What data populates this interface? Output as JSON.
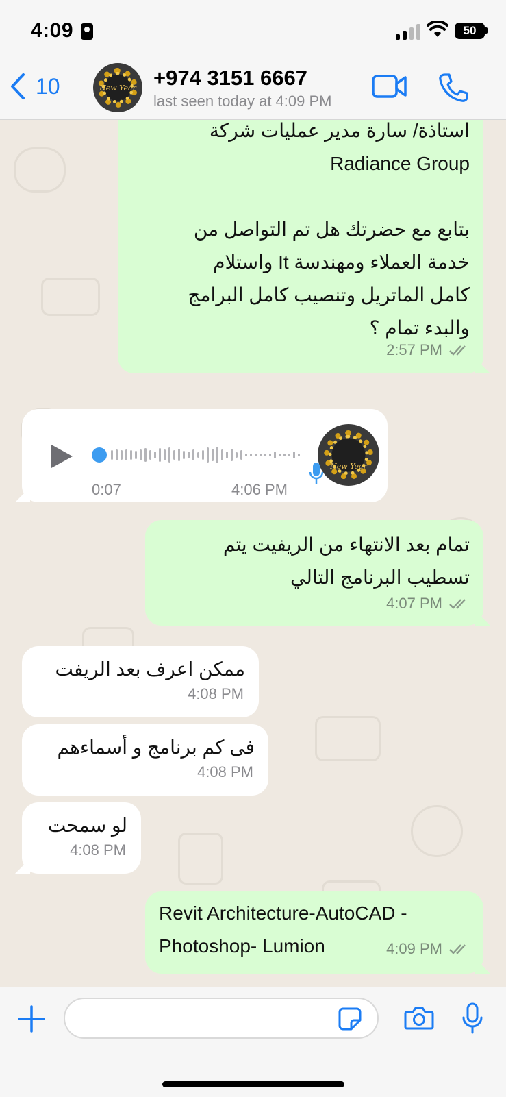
{
  "status_bar": {
    "time": "4:09",
    "battery": "50"
  },
  "header": {
    "back_count": "10",
    "contact_name": "+974 3151 6667",
    "last_seen": "last seen today at 4:09 PM",
    "avatar_text": "New Year",
    "icons": {
      "back": "chevron-left-icon",
      "video": "video-camera-icon",
      "call": "phone-icon"
    }
  },
  "messages": [
    {
      "direction": "out",
      "lines": [
        "استاذة/ سارة مدير عمليات شركة",
        "Radiance Group",
        "",
        "بتابع مع حضرتك هل تم التواصل من",
        "خدمة العملاء ومهندسة It واستلام",
        "كامل الماتريل وتنصيب كامل البرامج",
        "والبدء تمام ؟"
      ],
      "time": "2:57 PM",
      "status": "read"
    },
    {
      "direction": "in",
      "type": "voice",
      "duration": "0:07",
      "time": "4:06 PM"
    },
    {
      "direction": "out",
      "lines": [
        "تمام بعد الانتهاء من الريفيت يتم",
        "تسطيب البرنامج التالي"
      ],
      "time": "4:07 PM",
      "status": "read"
    },
    {
      "direction": "in",
      "text": "ممكن اعرف بعد الريفت",
      "time": "4:08 PM"
    },
    {
      "direction": "in",
      "text": "فى كم برنامج و أسماءهم",
      "time": "4:08 PM"
    },
    {
      "direction": "in",
      "text": "لو سمحت",
      "time": "4:08 PM"
    },
    {
      "direction": "out",
      "lines": [
        "Revit Architecture-AutoCAD -",
        "Photoshop- Lumion"
      ],
      "time": "4:09 PM",
      "status": "read"
    }
  ],
  "input_bar": {
    "placeholder": "",
    "icons": {
      "add": "plus-icon",
      "sticker": "sticker-icon",
      "camera": "camera-icon",
      "mic": "microphone-icon"
    }
  },
  "colors": {
    "accent": "#1b7cf4",
    "outgoing_bubble": "#d9fdd3",
    "incoming_bubble": "#ffffff",
    "chat_bg": "#efe9e1"
  }
}
